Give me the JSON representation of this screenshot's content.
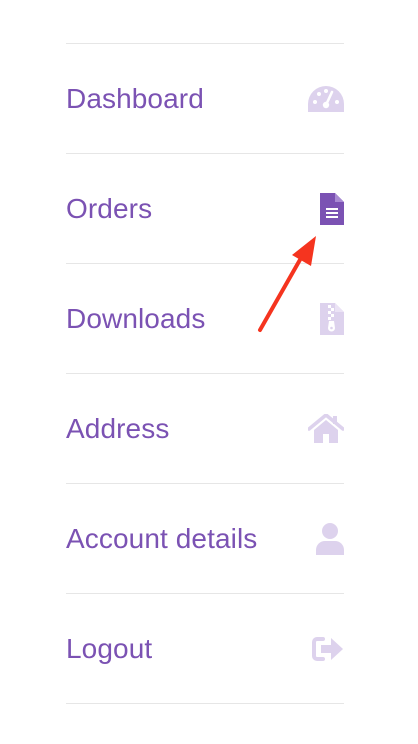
{
  "account_nav": {
    "items": [
      {
        "label": "Dashboard",
        "icon": "dashboard-gauge-icon",
        "active": false
      },
      {
        "label": "Orders",
        "icon": "file-text-icon",
        "active": true
      },
      {
        "label": "Downloads",
        "icon": "file-zip-icon",
        "active": false
      },
      {
        "label": "Address",
        "icon": "home-icon",
        "active": false
      },
      {
        "label": "Account details",
        "icon": "user-icon",
        "active": false
      },
      {
        "label": "Logout",
        "icon": "sign-out-icon",
        "active": false
      }
    ]
  },
  "colors": {
    "link_purple": "#7b52b3",
    "icon_active": "#7b52b3",
    "icon_inactive": "#ddd2ed",
    "divider": "#e6e6e6",
    "annotation_arrow": "#f5341f"
  }
}
